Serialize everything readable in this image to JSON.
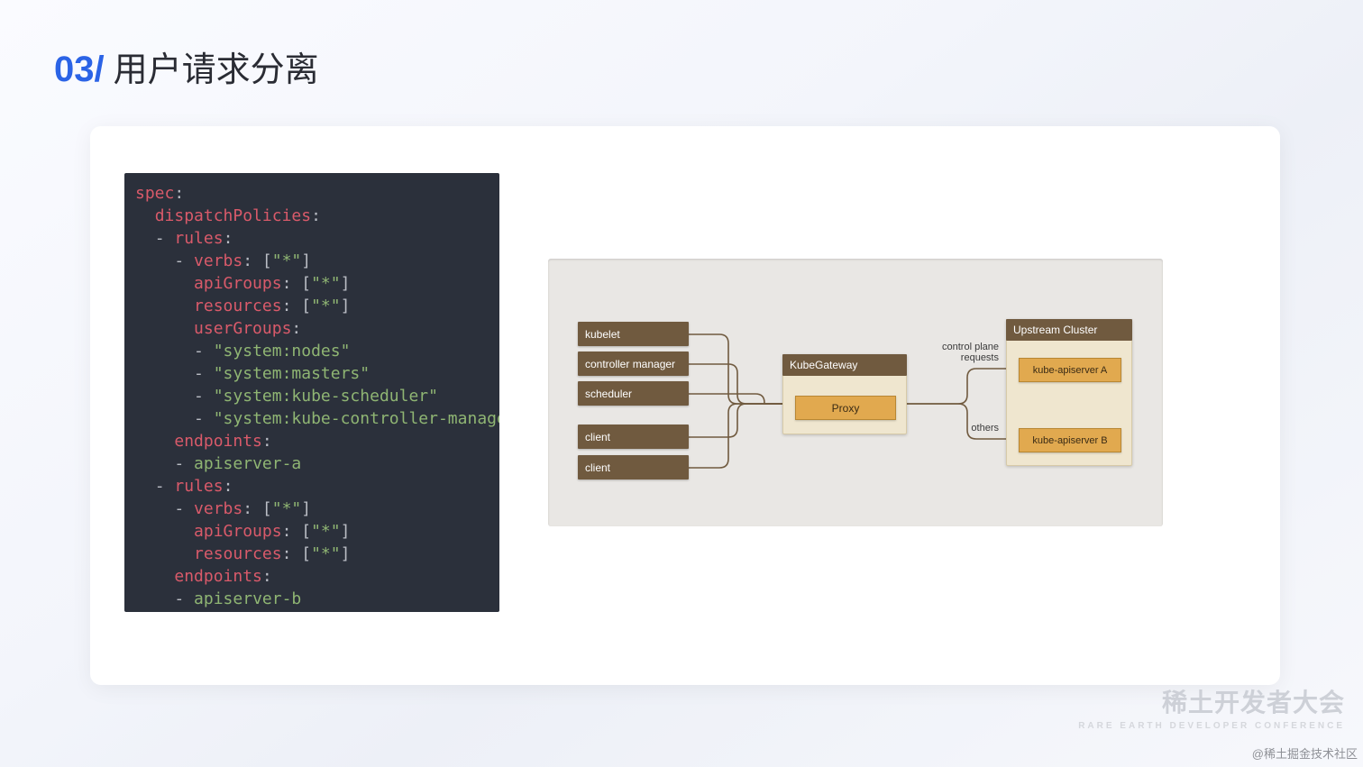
{
  "title": {
    "num": "03/",
    "text": "用户请求分离"
  },
  "code": {
    "lines": [
      [
        [
          "key",
          "spec"
        ],
        [
          "punc",
          ":"
        ]
      ],
      [
        [
          "plain",
          "  "
        ],
        [
          "key",
          "dispatchPolicies"
        ],
        [
          "punc",
          ":"
        ]
      ],
      [
        [
          "plain",
          "  "
        ],
        [
          "dash",
          "- "
        ],
        [
          "key",
          "rules"
        ],
        [
          "punc",
          ":"
        ]
      ],
      [
        [
          "plain",
          "    "
        ],
        [
          "dash",
          "- "
        ],
        [
          "key",
          "verbs"
        ],
        [
          "punc",
          ": ["
        ],
        [
          "str",
          "\"*\""
        ],
        [
          "punc",
          "]"
        ]
      ],
      [
        [
          "plain",
          "      "
        ],
        [
          "key",
          "apiGroups"
        ],
        [
          "punc",
          ": ["
        ],
        [
          "str",
          "\"*\""
        ],
        [
          "punc",
          "]"
        ]
      ],
      [
        [
          "plain",
          "      "
        ],
        [
          "key",
          "resources"
        ],
        [
          "punc",
          ": ["
        ],
        [
          "str",
          "\"*\""
        ],
        [
          "punc",
          "]"
        ]
      ],
      [
        [
          "plain",
          "      "
        ],
        [
          "key",
          "userGroups"
        ],
        [
          "punc",
          ":"
        ]
      ],
      [
        [
          "plain",
          "      "
        ],
        [
          "dash",
          "- "
        ],
        [
          "str",
          "\"system:nodes\""
        ]
      ],
      [
        [
          "plain",
          "      "
        ],
        [
          "dash",
          "- "
        ],
        [
          "str",
          "\"system:masters\""
        ]
      ],
      [
        [
          "plain",
          "      "
        ],
        [
          "dash",
          "- "
        ],
        [
          "str",
          "\"system:kube-scheduler\""
        ]
      ],
      [
        [
          "plain",
          "      "
        ],
        [
          "dash",
          "- "
        ],
        [
          "str",
          "\"system:kube-controller-manager\""
        ]
      ],
      [
        [
          "plain",
          "    "
        ],
        [
          "key",
          "endpoints"
        ],
        [
          "punc",
          ":"
        ]
      ],
      [
        [
          "plain",
          "    "
        ],
        [
          "dash",
          "- "
        ],
        [
          "str",
          "apiserver-a"
        ]
      ],
      [
        [
          "plain",
          "  "
        ],
        [
          "dash",
          "- "
        ],
        [
          "key",
          "rules"
        ],
        [
          "punc",
          ":"
        ]
      ],
      [
        [
          "plain",
          "    "
        ],
        [
          "dash",
          "- "
        ],
        [
          "key",
          "verbs"
        ],
        [
          "punc",
          ": ["
        ],
        [
          "str",
          "\"*\""
        ],
        [
          "punc",
          "]"
        ]
      ],
      [
        [
          "plain",
          "      "
        ],
        [
          "key",
          "apiGroups"
        ],
        [
          "punc",
          ": ["
        ],
        [
          "str",
          "\"*\""
        ],
        [
          "punc",
          "]"
        ]
      ],
      [
        [
          "plain",
          "      "
        ],
        [
          "key",
          "resources"
        ],
        [
          "punc",
          ": ["
        ],
        [
          "str",
          "\"*\""
        ],
        [
          "punc",
          "]"
        ]
      ],
      [
        [
          "plain",
          "    "
        ],
        [
          "key",
          "endpoints"
        ],
        [
          "punc",
          ":"
        ]
      ],
      [
        [
          "plain",
          "    "
        ],
        [
          "dash",
          "- "
        ],
        [
          "str",
          "apiserver-b"
        ]
      ]
    ]
  },
  "diagram": {
    "left_boxes_top": [
      "kubelet",
      "controller manager",
      "scheduler"
    ],
    "left_boxes_bottom": [
      "client",
      "client"
    ],
    "gateway_title": "KubeGateway",
    "proxy_label": "Proxy",
    "label_top": "control plane\nrequests",
    "label_bottom": "others",
    "upstream_title": "Upstream Cluster",
    "apiservers": [
      "kube-apiserver A",
      "kube-apiserver B"
    ]
  },
  "footer": {
    "brand_big": "稀土开发者大会",
    "brand_small": "RARE EARTH DEVELOPER CONFERENCE",
    "credit": "@稀土掘金技术社区"
  }
}
